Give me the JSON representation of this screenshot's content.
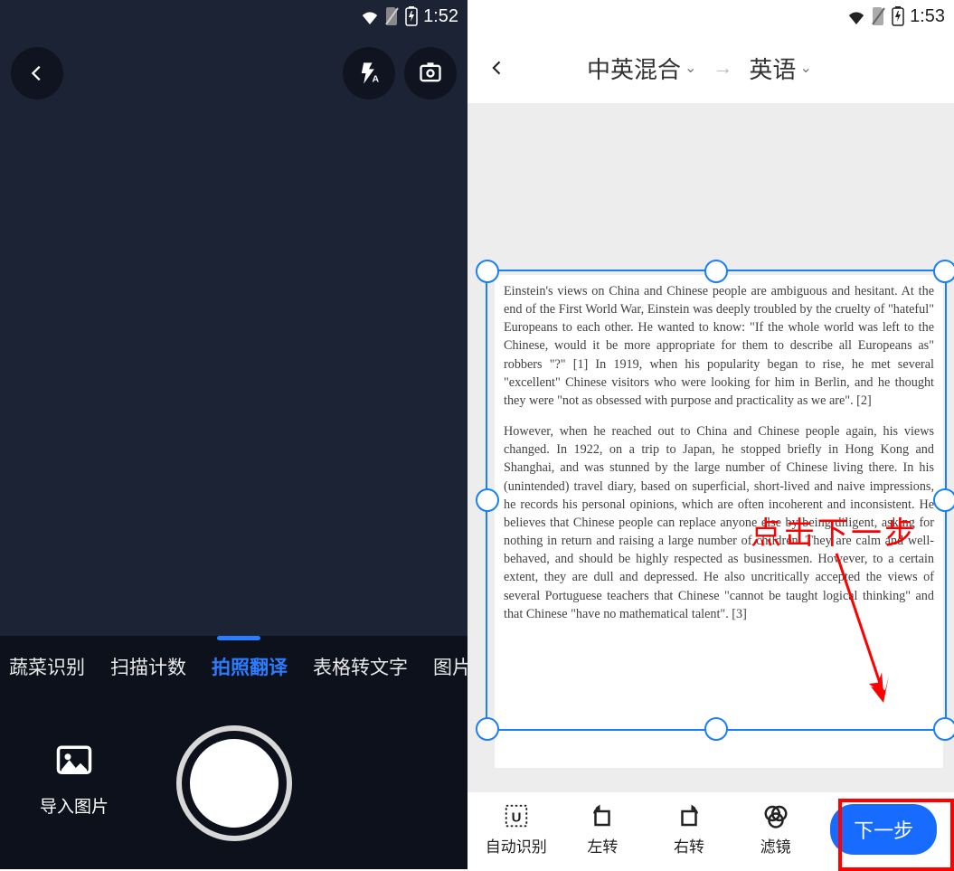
{
  "left": {
    "statusbar": {
      "time": "1:52"
    },
    "tabs": {
      "items": [
        "蔬菜识别",
        "扫描计数",
        "拍照翻译",
        "表格转文字",
        "图片转w"
      ],
      "active_index": 2
    },
    "import_label": "导入图片"
  },
  "right": {
    "statusbar": {
      "time": "1:53"
    },
    "header": {
      "source_lang": "中英混合",
      "target_lang": "英语"
    },
    "document": {
      "paragraph1": "Einstein's views on China and Chinese people are ambiguous and hesitant. At the end of the First World War, Einstein was deeply troubled by the cruelty of \"hateful\" Europeans to each other. He wanted to know: \"If the whole world was left to the Chinese, would it be more appropriate for them to describe all Europeans as\" robbers \"?\" [1] In 1919, when his popularity began to rise, he met several \"excellent\" Chinese visitors who were looking for him in Berlin, and he thought they were \"not as obsessed with purpose and practicality as we are\". [2]",
      "paragraph2": "However, when he reached out to China and Chinese people again, his views changed. In 1922, on a trip to Japan, he stopped briefly in Hong Kong and Shanghai, and was stunned by the large number of Chinese living there. In his (unintended) travel diary, based on superficial, short-lived and naive impressions, he records his personal opinions, which are often incoherent and inconsistent. He believes that Chinese people can replace anyone else by being diligent, asking for nothing in return and raising a large number of children. They are calm and well-behaved, and should be highly respected as businessmen. However, to a certain extent, they are dull and depressed. He also uncritically accepted the views of several Portuguese teachers that Chinese \"cannot be taught logical thinking\" and that Chinese \"have no mathematical talent\". [3]"
    },
    "annotation": "点击下一步",
    "actions": {
      "auto_detect": "自动识别",
      "rotate_left": "左转",
      "rotate_right": "右转",
      "filter": "滤镜",
      "next": "下一步"
    }
  }
}
